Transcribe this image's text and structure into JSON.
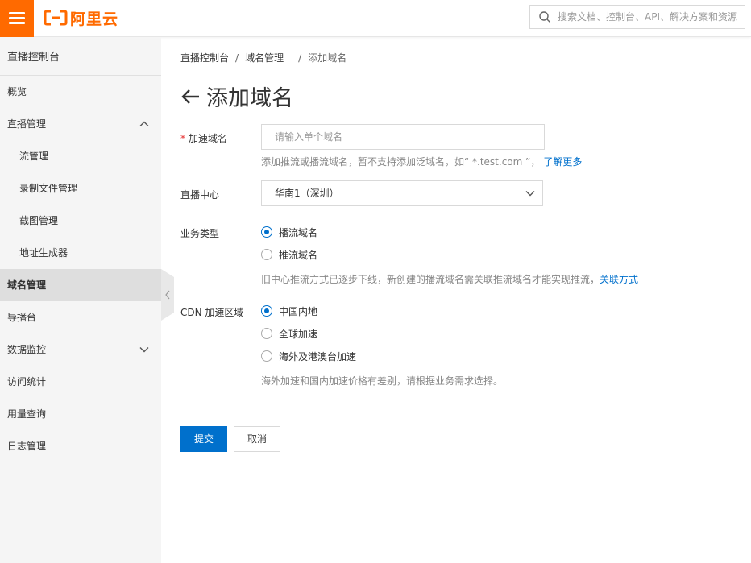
{
  "header": {
    "logo_text": "阿里云",
    "search_placeholder": "搜索文档、控制台、API、解决方案和资源",
    "brand_color": "#ff6a00"
  },
  "sidebar": {
    "title": "直播控制台",
    "items": [
      {
        "label": "概览"
      },
      {
        "label": "直播管理",
        "expanded": true
      },
      {
        "label": "流管理"
      },
      {
        "label": "录制文件管理"
      },
      {
        "label": "截图管理"
      },
      {
        "label": "地址生成器"
      },
      {
        "label": "域名管理",
        "active": true
      },
      {
        "label": "导播台"
      },
      {
        "label": "数据监控",
        "expanded": false
      },
      {
        "label": "访问统计"
      },
      {
        "label": "用量查询"
      },
      {
        "label": "日志管理"
      }
    ]
  },
  "breadcrumb": {
    "items": [
      "直播控制台",
      "域名管理",
      "添加域名"
    ],
    "separator": "/"
  },
  "page": {
    "title": "添加域名"
  },
  "form": {
    "domain": {
      "required_mark": "*",
      "label": "加速域名",
      "placeholder": "请输入单个域名",
      "value": "",
      "hint": "添加推流或播流域名，暂不支持添加泛域名，如“ *.test.com ”，",
      "hint_link": "了解更多"
    },
    "center": {
      "label": "直播中心",
      "selected": "华南1（深圳）"
    },
    "business_type": {
      "label": "业务类型",
      "options": [
        {
          "label": "播流域名",
          "checked": true
        },
        {
          "label": "推流域名",
          "checked": false
        }
      ],
      "hint": "旧中心推流方式已逐步下线，新创建的播流域名需关联推流域名才能实现推流，",
      "hint_link": "关联方式"
    },
    "cdn_region": {
      "label": "CDN 加速区域",
      "options": [
        {
          "label": "中国内地",
          "checked": true
        },
        {
          "label": "全球加速",
          "checked": false
        },
        {
          "label": "海外及港澳台加速",
          "checked": false
        }
      ],
      "hint": "海外加速和国内加速价格有差别，请根据业务需求选择。"
    },
    "submit_label": "提交",
    "cancel_label": "取消"
  },
  "colors": {
    "primary": "#0070cc",
    "required": "#e62e2e",
    "sidebar_bg": "#f5f5f5",
    "sidebar_active_bg": "#dedede"
  }
}
